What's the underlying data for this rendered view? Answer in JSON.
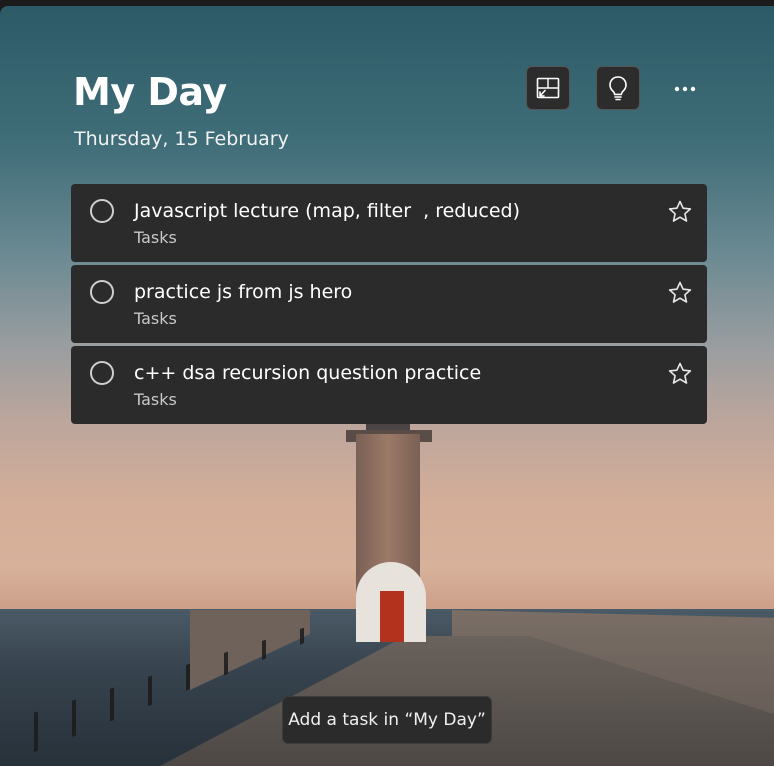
{
  "header": {
    "title": "My Day",
    "date": "Thursday, 15 February",
    "buttons": [
      {
        "icon": "background-image-icon"
      },
      {
        "icon": "lightbulb-suggestions-icon"
      },
      {
        "icon": "more-options-icon"
      }
    ]
  },
  "tasks": [
    {
      "title": "Javascript lecture (map, filter  , reduced)",
      "list": "Tasks",
      "important": false,
      "completed": false
    },
    {
      "title": "practice js from js hero",
      "list": "Tasks",
      "important": false,
      "completed": false
    },
    {
      "title": "c++ dsa recursion question practice",
      "list": "Tasks",
      "important": false,
      "completed": false
    }
  ],
  "add_task": {
    "label": "Add a task in “My Day”"
  },
  "colors": {
    "task_card": "#2b2b2b",
    "text": "#ffffff",
    "secondary_text": "#c8c8c8"
  }
}
